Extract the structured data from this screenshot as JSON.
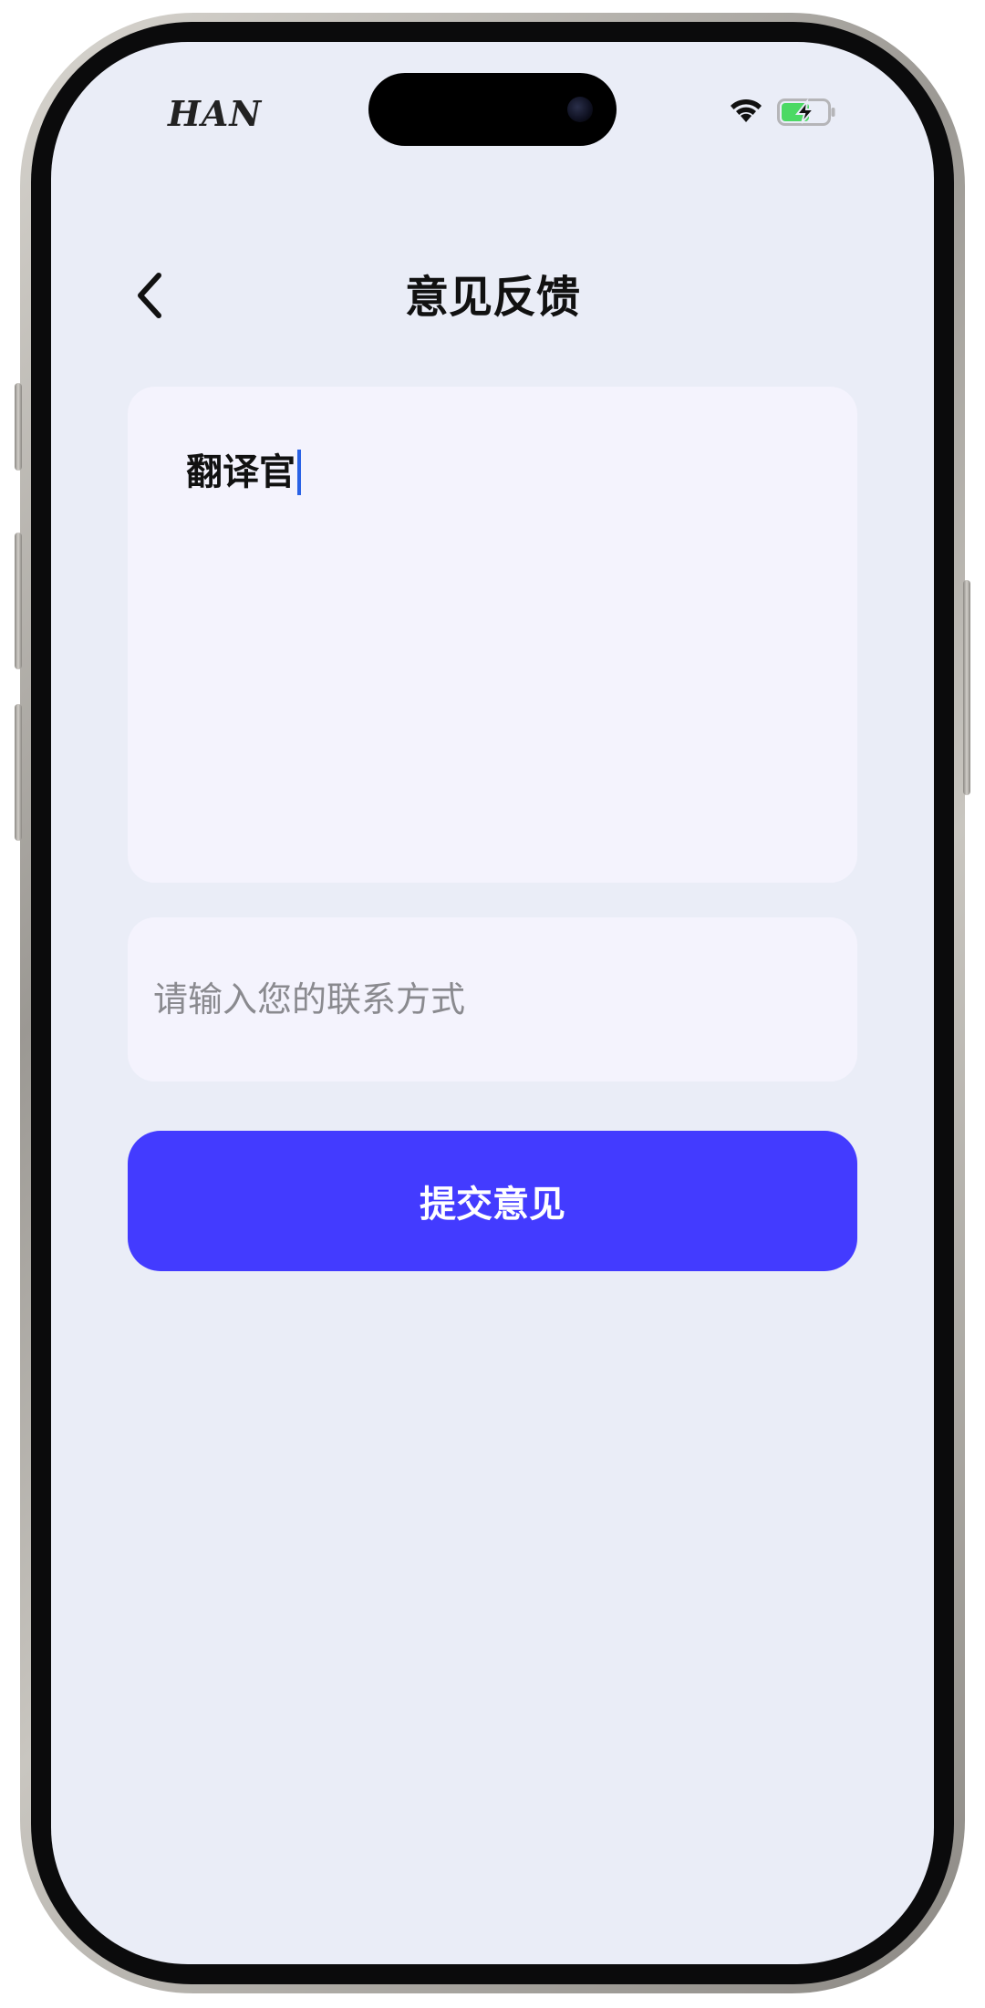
{
  "status_bar": {
    "carrier": "HAN",
    "wifi_icon": "wifi-icon",
    "battery_icon": "battery-charging-icon"
  },
  "nav": {
    "back_icon": "chevron-left-icon",
    "title": "意见反馈"
  },
  "feedback": {
    "value": "翻译官"
  },
  "contact": {
    "placeholder": "请输入您的联系方式"
  },
  "submit": {
    "label": "提交意见",
    "color": "#433bff"
  },
  "colors": {
    "background": "#eaedf7",
    "card": "#f4f3fd",
    "accent": "#433bff",
    "battery_green": "#4cd964",
    "caret": "#2a62e6"
  }
}
